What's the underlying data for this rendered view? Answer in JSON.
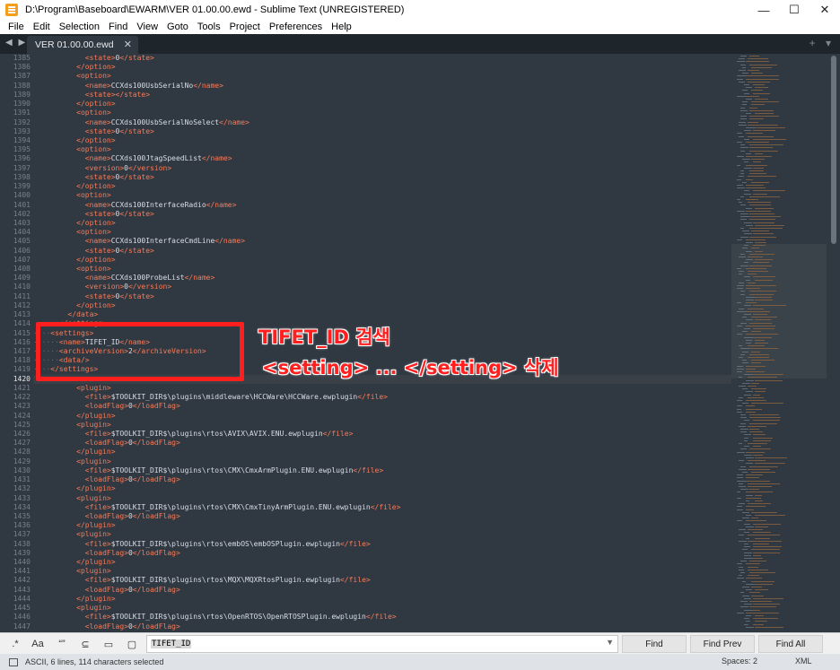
{
  "window": {
    "title": "D:\\Program\\Baseboard\\EWARM\\VER 01.00.00.ewd - Sublime Text (UNREGISTERED)",
    "controls": [
      "—",
      "☐",
      "✕"
    ]
  },
  "menu": [
    "File",
    "Edit",
    "Selection",
    "Find",
    "View",
    "Goto",
    "Tools",
    "Project",
    "Preferences",
    "Help"
  ],
  "tabs": {
    "nav": "◀ ▶",
    "active": "VER 01.00.00.ewd",
    "close": "✕",
    "right": "+ ▾"
  },
  "editor": {
    "current_line": 1420,
    "lines": [
      {
        "n": 1385,
        "c": "            <state>0</state>"
      },
      {
        "n": 1386,
        "c": "          </option>"
      },
      {
        "n": 1387,
        "c": "          <option>"
      },
      {
        "n": 1388,
        "c": "            <name>CCXds100UsbSerialNo</name>"
      },
      {
        "n": 1389,
        "c": "            <state></state>"
      },
      {
        "n": 1390,
        "c": "          </option>"
      },
      {
        "n": 1391,
        "c": "          <option>"
      },
      {
        "n": 1392,
        "c": "            <name>CCXds100UsbSerialNoSelect</name>"
      },
      {
        "n": 1393,
        "c": "            <state>0</state>"
      },
      {
        "n": 1394,
        "c": "          </option>"
      },
      {
        "n": 1395,
        "c": "          <option>"
      },
      {
        "n": 1396,
        "c": "            <name>CCXds100JtagSpeedList</name>"
      },
      {
        "n": 1397,
        "c": "            <version>0</version>"
      },
      {
        "n": 1398,
        "c": "            <state>0</state>"
      },
      {
        "n": 1399,
        "c": "          </option>"
      },
      {
        "n": 1400,
        "c": "          <option>"
      },
      {
        "n": 1401,
        "c": "            <name>CCXds100InterfaceRadio</name>"
      },
      {
        "n": 1402,
        "c": "            <state>0</state>"
      },
      {
        "n": 1403,
        "c": "          </option>"
      },
      {
        "n": 1404,
        "c": "          <option>"
      },
      {
        "n": 1405,
        "c": "            <name>CCXds100InterfaceCmdLine</name>"
      },
      {
        "n": 1406,
        "c": "            <state>0</state>"
      },
      {
        "n": 1407,
        "c": "          </option>"
      },
      {
        "n": 1408,
        "c": "          <option>"
      },
      {
        "n": 1409,
        "c": "            <name>CCXds100ProbeList</name>"
      },
      {
        "n": 1410,
        "c": "            <version>0</version>"
      },
      {
        "n": 1411,
        "c": "            <state>0</state>"
      },
      {
        "n": 1412,
        "c": "          </option>"
      },
      {
        "n": 1413,
        "c": "        </data>"
      },
      {
        "n": 1414,
        "c": "      </settings>"
      },
      {
        "n": 1415,
        "c": "····<settings>",
        "sel": true
      },
      {
        "n": 1416,
        "c": "······<name>TIFET_ID</name>",
        "sel": true
      },
      {
        "n": 1417,
        "c": "······<archiveVersion>2</archiveVersion>",
        "sel": true
      },
      {
        "n": 1418,
        "c": "······<data/>",
        "sel": true
      },
      {
        "n": 1419,
        "c": "····</settings>",
        "sel": true
      },
      {
        "n": 1420,
        "c": ""
      },
      {
        "n": 1421,
        "c": "          <plugin>"
      },
      {
        "n": 1422,
        "c": "            <file>$TOOLKIT_DIR$\\plugins\\middleware\\HCCWare\\HCCWare.ewplugin</file>"
      },
      {
        "n": 1423,
        "c": "            <loadFlag>0</loadFlag>"
      },
      {
        "n": 1424,
        "c": "          </plugin>"
      },
      {
        "n": 1425,
        "c": "          <plugin>"
      },
      {
        "n": 1426,
        "c": "            <file>$TOOLKIT_DIR$\\plugins\\rtos\\AVIX\\AVIX.ENU.ewplugin</file>"
      },
      {
        "n": 1427,
        "c": "            <loadFlag>0</loadFlag>"
      },
      {
        "n": 1428,
        "c": "          </plugin>"
      },
      {
        "n": 1429,
        "c": "          <plugin>"
      },
      {
        "n": 1430,
        "c": "            <file>$TOOLKIT_DIR$\\plugins\\rtos\\CMX\\CmxArmPlugin.ENU.ewplugin</file>"
      },
      {
        "n": 1431,
        "c": "            <loadFlag>0</loadFlag>"
      },
      {
        "n": 1432,
        "c": "          </plugin>"
      },
      {
        "n": 1433,
        "c": "          <plugin>"
      },
      {
        "n": 1434,
        "c": "            <file>$TOOLKIT_DIR$\\plugins\\rtos\\CMX\\CmxTinyArmPlugin.ENU.ewplugin</file>"
      },
      {
        "n": 1435,
        "c": "            <loadFlag>0</loadFlag>"
      },
      {
        "n": 1436,
        "c": "          </plugin>"
      },
      {
        "n": 1437,
        "c": "          <plugin>"
      },
      {
        "n": 1438,
        "c": "            <file>$TOOLKIT_DIR$\\plugins\\rtos\\embOS\\embOSPlugin.ewplugin</file>"
      },
      {
        "n": 1439,
        "c": "            <loadFlag>0</loadFlag>"
      },
      {
        "n": 1440,
        "c": "          </plugin>"
      },
      {
        "n": 1441,
        "c": "          <plugin>"
      },
      {
        "n": 1442,
        "c": "            <file>$TOOLKIT_DIR$\\plugins\\rtos\\MQX\\MQXRtosPlugin.ewplugin</file>"
      },
      {
        "n": 1443,
        "c": "            <loadFlag>0</loadFlag>"
      },
      {
        "n": 1444,
        "c": "          </plugin>"
      },
      {
        "n": 1445,
        "c": "          <plugin>"
      },
      {
        "n": 1446,
        "c": "            <file>$TOOLKIT_DIR$\\plugins\\rtos\\OpenRTOS\\OpenRTOSPlugin.ewplugin</file>"
      },
      {
        "n": 1447,
        "c": "            <loadFlag>0</loadFlag>"
      }
    ]
  },
  "annotation": {
    "line1": "TIFET_ID 검색",
    "line2": "<setting> ... </setting> 삭제"
  },
  "find": {
    "options": [
      ".*",
      "Aa",
      "“”",
      "⊆",
      "▭",
      "▢"
    ],
    "query": "TIFET_ID",
    "buttons": {
      "find": "Find",
      "find_prev": "Find Prev",
      "find_all": "Find All"
    }
  },
  "status": {
    "left": "ASCII, 6 lines, 114 characters selected",
    "spaces": "Spaces: 2",
    "syntax": "XML"
  },
  "colors": {
    "editor_bg": "#303841",
    "tag": "#f97b58",
    "annotation": "#ff1f1f",
    "selection": "#4f5b66"
  }
}
